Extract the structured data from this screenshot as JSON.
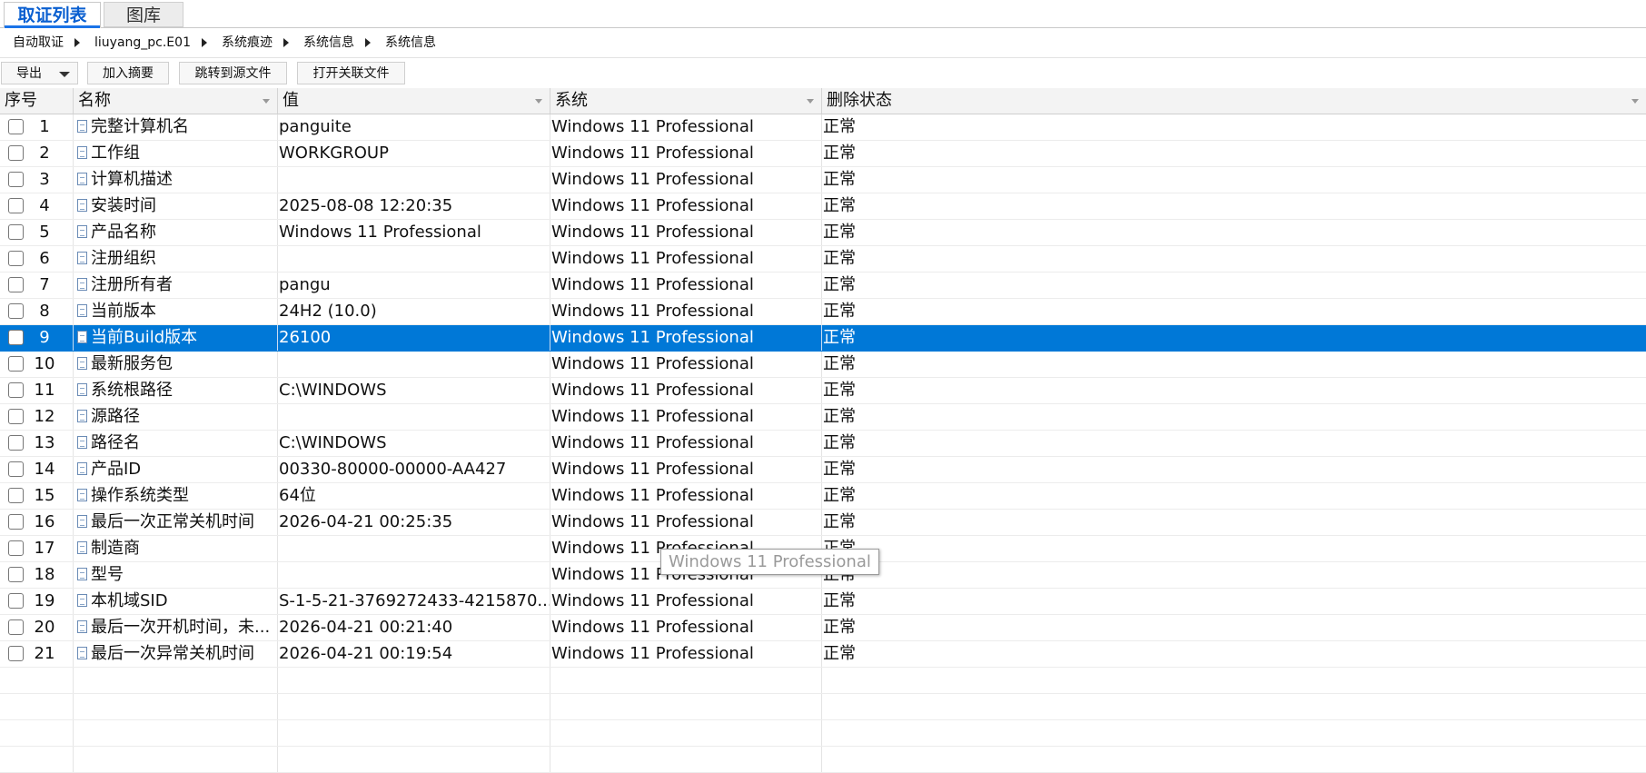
{
  "tabs": [
    {
      "label": "取证列表",
      "active": true
    },
    {
      "label": "图库",
      "active": false
    }
  ],
  "breadcrumb": [
    "自动取证",
    "liuyang_pc.E01",
    "系统痕迹",
    "系统信息",
    "系统信息"
  ],
  "toolbar": {
    "export_label": "导出",
    "add_summary_label": "加入摘要",
    "jump_source_label": "跳转到源文件",
    "open_related_label": "打开关联文件"
  },
  "columns": [
    "序号",
    "名称",
    "值",
    "系统",
    "删除状态"
  ],
  "rows": [
    {
      "no": "1",
      "name": "完整计算机名",
      "value": "panguite",
      "system": "Windows 11 Professional",
      "status": "正常"
    },
    {
      "no": "2",
      "name": "工作组",
      "value": "WORKGROUP",
      "system": "Windows 11 Professional",
      "status": "正常"
    },
    {
      "no": "3",
      "name": "计算机描述",
      "value": "",
      "system": "Windows 11 Professional",
      "status": "正常"
    },
    {
      "no": "4",
      "name": "安装时间",
      "value": "2025-08-08 12:20:35",
      "system": "Windows 11 Professional",
      "status": "正常"
    },
    {
      "no": "5",
      "name": "产品名称",
      "value": "Windows 11 Professional",
      "system": "Windows 11 Professional",
      "status": "正常"
    },
    {
      "no": "6",
      "name": "注册组织",
      "value": "",
      "system": "Windows 11 Professional",
      "status": "正常"
    },
    {
      "no": "7",
      "name": "注册所有者",
      "value": "pangu",
      "system": "Windows 11 Professional",
      "status": "正常"
    },
    {
      "no": "8",
      "name": "当前版本",
      "value": "24H2 (10.0)",
      "system": "Windows 11 Professional",
      "status": "正常"
    },
    {
      "no": "9",
      "name": "当前Build版本",
      "value": "26100",
      "system": "Windows 11 Professional",
      "status": "正常",
      "selected": true
    },
    {
      "no": "10",
      "name": "最新服务包",
      "value": "",
      "system": "Windows 11 Professional",
      "status": "正常"
    },
    {
      "no": "11",
      "name": "系统根路径",
      "value": "C:\\WINDOWS",
      "system": "Windows 11 Professional",
      "status": "正常"
    },
    {
      "no": "12",
      "name": "源路径",
      "value": "",
      "system": "Windows 11 Professional",
      "status": "正常"
    },
    {
      "no": "13",
      "name": "路径名",
      "value": "C:\\WINDOWS",
      "system": "Windows 11 Professional",
      "status": "正常"
    },
    {
      "no": "14",
      "name": "产品ID",
      "value": "00330-80000-00000-AA427",
      "system": "Windows 11 Professional",
      "status": "正常"
    },
    {
      "no": "15",
      "name": "操作系统类型",
      "value": "64位",
      "system": "Windows 11 Professional",
      "status": "正常"
    },
    {
      "no": "16",
      "name": "最后一次正常关机时间",
      "value": "2026-04-21 00:25:35",
      "system": "Windows 11 Professional",
      "status": "正常"
    },
    {
      "no": "17",
      "name": "制造商",
      "value": "",
      "system": "Windows 11 Professional",
      "status": "正常"
    },
    {
      "no": "18",
      "name": "型号",
      "value": "",
      "system": "Windows 11 Professional",
      "status": "正常"
    },
    {
      "no": "19",
      "name": "本机域SID",
      "value": "S-1-5-21-3769272433-4215870...",
      "system": "Windows 11 Professional",
      "status": "正常"
    },
    {
      "no": "20",
      "name": "最后一次开机时间，未...",
      "value": "2026-04-21 00:21:40",
      "system": "Windows 11 Professional",
      "status": "正常"
    },
    {
      "no": "21",
      "name": "最后一次异常关机时间",
      "value": "2026-04-21 00:19:54",
      "system": "Windows 11 Professional",
      "status": "正常"
    }
  ],
  "tooltip": "Windows 11 Professional",
  "colors": {
    "accent": "#1a73e8",
    "selected_row": "#0078d7"
  }
}
